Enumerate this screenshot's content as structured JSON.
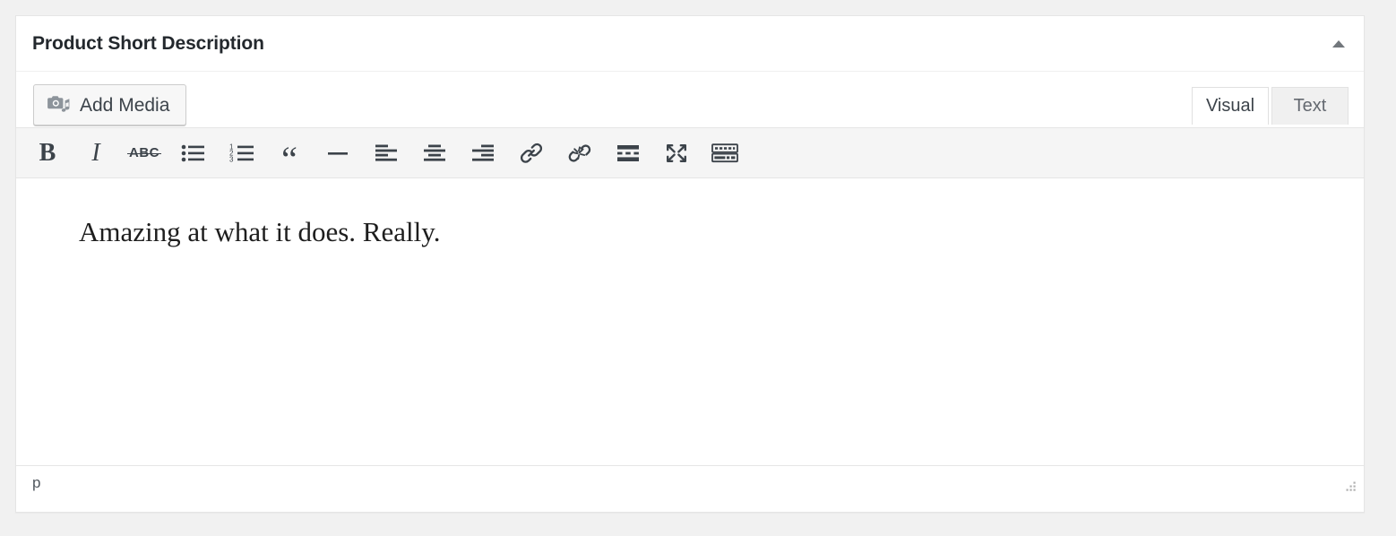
{
  "panel": {
    "title": "Product Short Description",
    "collapse_icon": "caret-up-icon"
  },
  "editor": {
    "media_button": {
      "label": "Add Media",
      "icon": "media-camera-note-icon"
    },
    "tabs": [
      {
        "label": "Visual",
        "active": true
      },
      {
        "label": "Text",
        "active": false
      }
    ],
    "toolbar": [
      {
        "name": "bold",
        "title": "Bold",
        "glyph": "B"
      },
      {
        "name": "italic",
        "title": "Italic",
        "glyph": "I"
      },
      {
        "name": "strikethrough",
        "title": "Strikethrough",
        "glyph": "ABC"
      },
      {
        "name": "bullist",
        "title": "Bulleted list",
        "glyph": ""
      },
      {
        "name": "numlist",
        "title": "Numbered list",
        "glyph": ""
      },
      {
        "name": "blockquote",
        "title": "Blockquote",
        "glyph": "“"
      },
      {
        "name": "hr",
        "title": "Horizontal line",
        "glyph": ""
      },
      {
        "name": "alignleft",
        "title": "Align left",
        "glyph": ""
      },
      {
        "name": "aligncenter",
        "title": "Align center",
        "glyph": ""
      },
      {
        "name": "alignright",
        "title": "Align right",
        "glyph": ""
      },
      {
        "name": "link",
        "title": "Insert/edit link",
        "glyph": ""
      },
      {
        "name": "unlink",
        "title": "Remove link",
        "glyph": ""
      },
      {
        "name": "more",
        "title": "Insert Read More tag",
        "glyph": ""
      },
      {
        "name": "fullscreen",
        "title": "Distraction-free writing mode",
        "glyph": ""
      },
      {
        "name": "toolbartoggle",
        "title": "Toolbar Toggle",
        "glyph": ""
      }
    ],
    "content": {
      "paragraph": "Amazing at what it does. Really."
    },
    "statusbar": {
      "path": "p",
      "resize_handle": "resize-grip-icon"
    }
  },
  "colors": {
    "page_background": "#f1f1f1",
    "panel_background": "#ffffff",
    "panel_border": "#e5e5e5",
    "toolbar_background": "#f5f5f5",
    "title_text": "#23282d",
    "icon": "#3c434a",
    "tab_inactive_background": "#f0f0f0"
  }
}
